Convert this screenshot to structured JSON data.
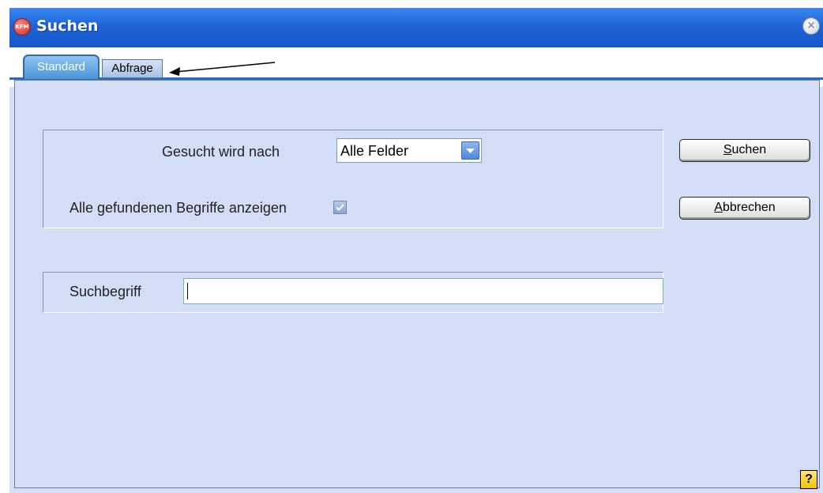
{
  "window": {
    "title": "Suchen",
    "icon_label": "KFM",
    "close_glyph": "×"
  },
  "tabs": [
    {
      "label": "Standard",
      "active": true
    },
    {
      "label": "Abfrage",
      "active": false
    }
  ],
  "form": {
    "search_for_label": "Gesucht wird nach",
    "search_for_value": "Alle Felder",
    "show_all_label": "Alle gefundenen Begriffe anzeigen",
    "show_all_checked": true,
    "term_label": "Suchbegriff",
    "term_value": ""
  },
  "buttons": {
    "search": {
      "mnemonic": "S",
      "rest": "uchen"
    },
    "cancel": {
      "mnemonic": "A",
      "rest": "bbrechen"
    },
    "help": "?"
  },
  "colors": {
    "title_bar": "#1f63d6",
    "tab_active": "#4b95d9",
    "dialog_bg": "#d4ddf6"
  },
  "icons": [
    "kfm-app-icon",
    "close-icon",
    "dropdown-arrow-icon",
    "checkmark-icon",
    "help-icon",
    "arrow-annotation-icon"
  ]
}
